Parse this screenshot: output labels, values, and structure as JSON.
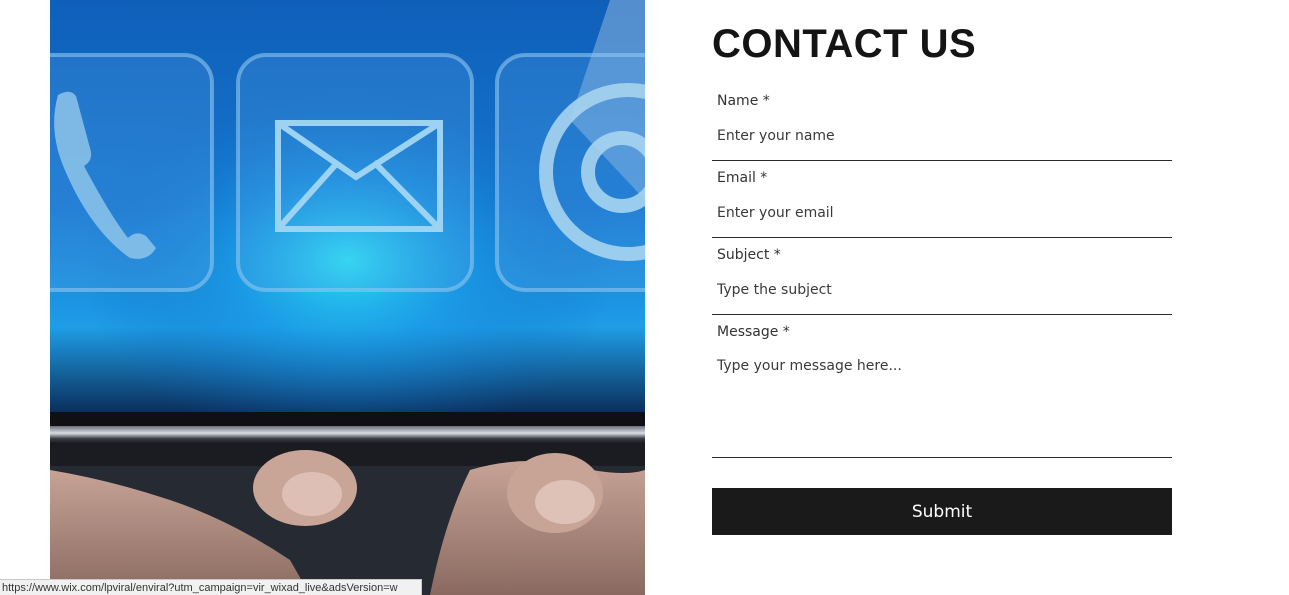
{
  "hero": {
    "image_description_icons": [
      "phone-icon",
      "envelope-icon",
      "at-sign-icon"
    ]
  },
  "contact": {
    "title": "CONTACT US",
    "fields": {
      "name": {
        "label": "Name *",
        "placeholder": "Enter your name",
        "value": ""
      },
      "email": {
        "label": "Email *",
        "placeholder": "Enter your email",
        "value": ""
      },
      "subject": {
        "label": "Subject *",
        "placeholder": "Type the subject",
        "value": ""
      },
      "message": {
        "label": "Message *",
        "placeholder": "Type your message here...",
        "value": ""
      }
    },
    "submit_label": "Submit"
  },
  "statusbar": {
    "url": "https://www.wix.com/lpviral/enviral?utm_campaign=vir_wixad_live&adsVersion=w"
  },
  "colors": {
    "button_bg": "#1a1a1a",
    "button_text": "#ffffff",
    "accent_blue": "#1e9de6"
  }
}
